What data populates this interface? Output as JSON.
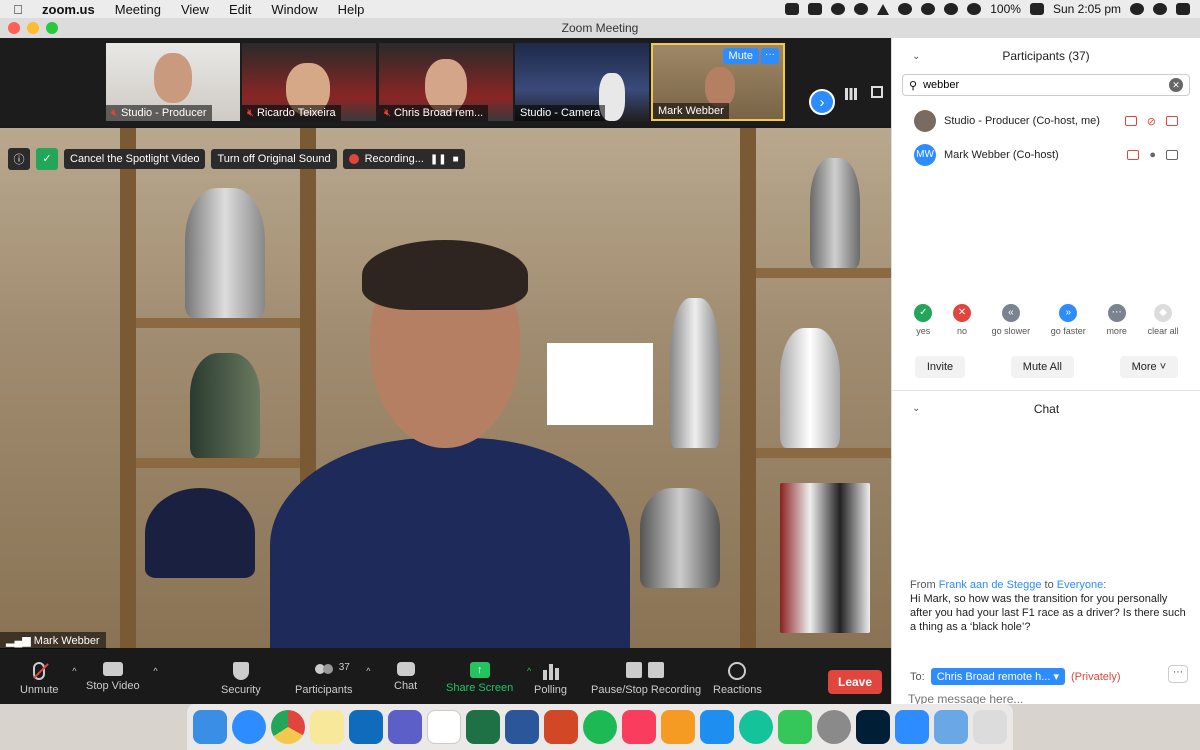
{
  "menubar": {
    "app_name": "zoom.us",
    "items": [
      "Meeting",
      "View",
      "Edit",
      "Window",
      "Help"
    ],
    "battery": "100%",
    "clock": "Sun 2:05 pm"
  },
  "window": {
    "title": "Zoom Meeting"
  },
  "thumbnails": [
    {
      "name": "Studio - Producer",
      "muted": true
    },
    {
      "name": "Ricardo Teixeira",
      "muted": true
    },
    {
      "name": "Chris Broad rem...",
      "muted": true
    },
    {
      "name": "Studio - Camera",
      "muted": false
    },
    {
      "name": "Mark Webber",
      "muted": false,
      "active": true
    }
  ],
  "thumb_controls": {
    "mute_label": "Mute",
    "more_label": "···"
  },
  "spotlight_bar": {
    "cancel_spotlight": "Cancel the Spotlight Video",
    "original_sound": "Turn off Original Sound",
    "recording": "Recording..."
  },
  "main_video": {
    "speaker_name": "Mark Webber"
  },
  "toolbar": {
    "unmute": "Unmute",
    "stop_video": "Stop Video",
    "security": "Security",
    "participants": "Participants",
    "participant_count": "37",
    "chat": "Chat",
    "share_screen": "Share Screen",
    "polling": "Polling",
    "pause_stop_recording": "Pause/Stop Recording",
    "reactions": "Reactions",
    "leave": "Leave"
  },
  "participants_panel": {
    "title": "Participants (37)",
    "search_value": "webber",
    "rows": [
      {
        "name": "Studio - Producer (Co-host, me)"
      },
      {
        "name": "Mark Webber (Co-host)",
        "initials": "MW"
      }
    ],
    "feedback": [
      {
        "label": "yes"
      },
      {
        "label": "no"
      },
      {
        "label": "go slower"
      },
      {
        "label": "go faster"
      },
      {
        "label": "more"
      },
      {
        "label": "clear all"
      }
    ],
    "actions": {
      "invite": "Invite",
      "mute_all": "Mute All",
      "more": "More"
    }
  },
  "chat_panel": {
    "title": "Chat",
    "message": {
      "from_prefix": "From ",
      "sender": "Frank aan de Stegge",
      "to_word": " to ",
      "recipient": "Everyone",
      "colon": ":",
      "text": "Hi Mark, so how was the transition for you personally after you had your last F1 race as a driver? Is there such a thing as a ‘black hole’?"
    },
    "to_label": "To:",
    "to_value": "Chris Broad remote h...",
    "privately": "(Privately)",
    "input_placeholder": "Type message here..."
  },
  "colors": {
    "accent": "#2d8cff",
    "leave": "#e0463d",
    "share": "#23c45e"
  }
}
